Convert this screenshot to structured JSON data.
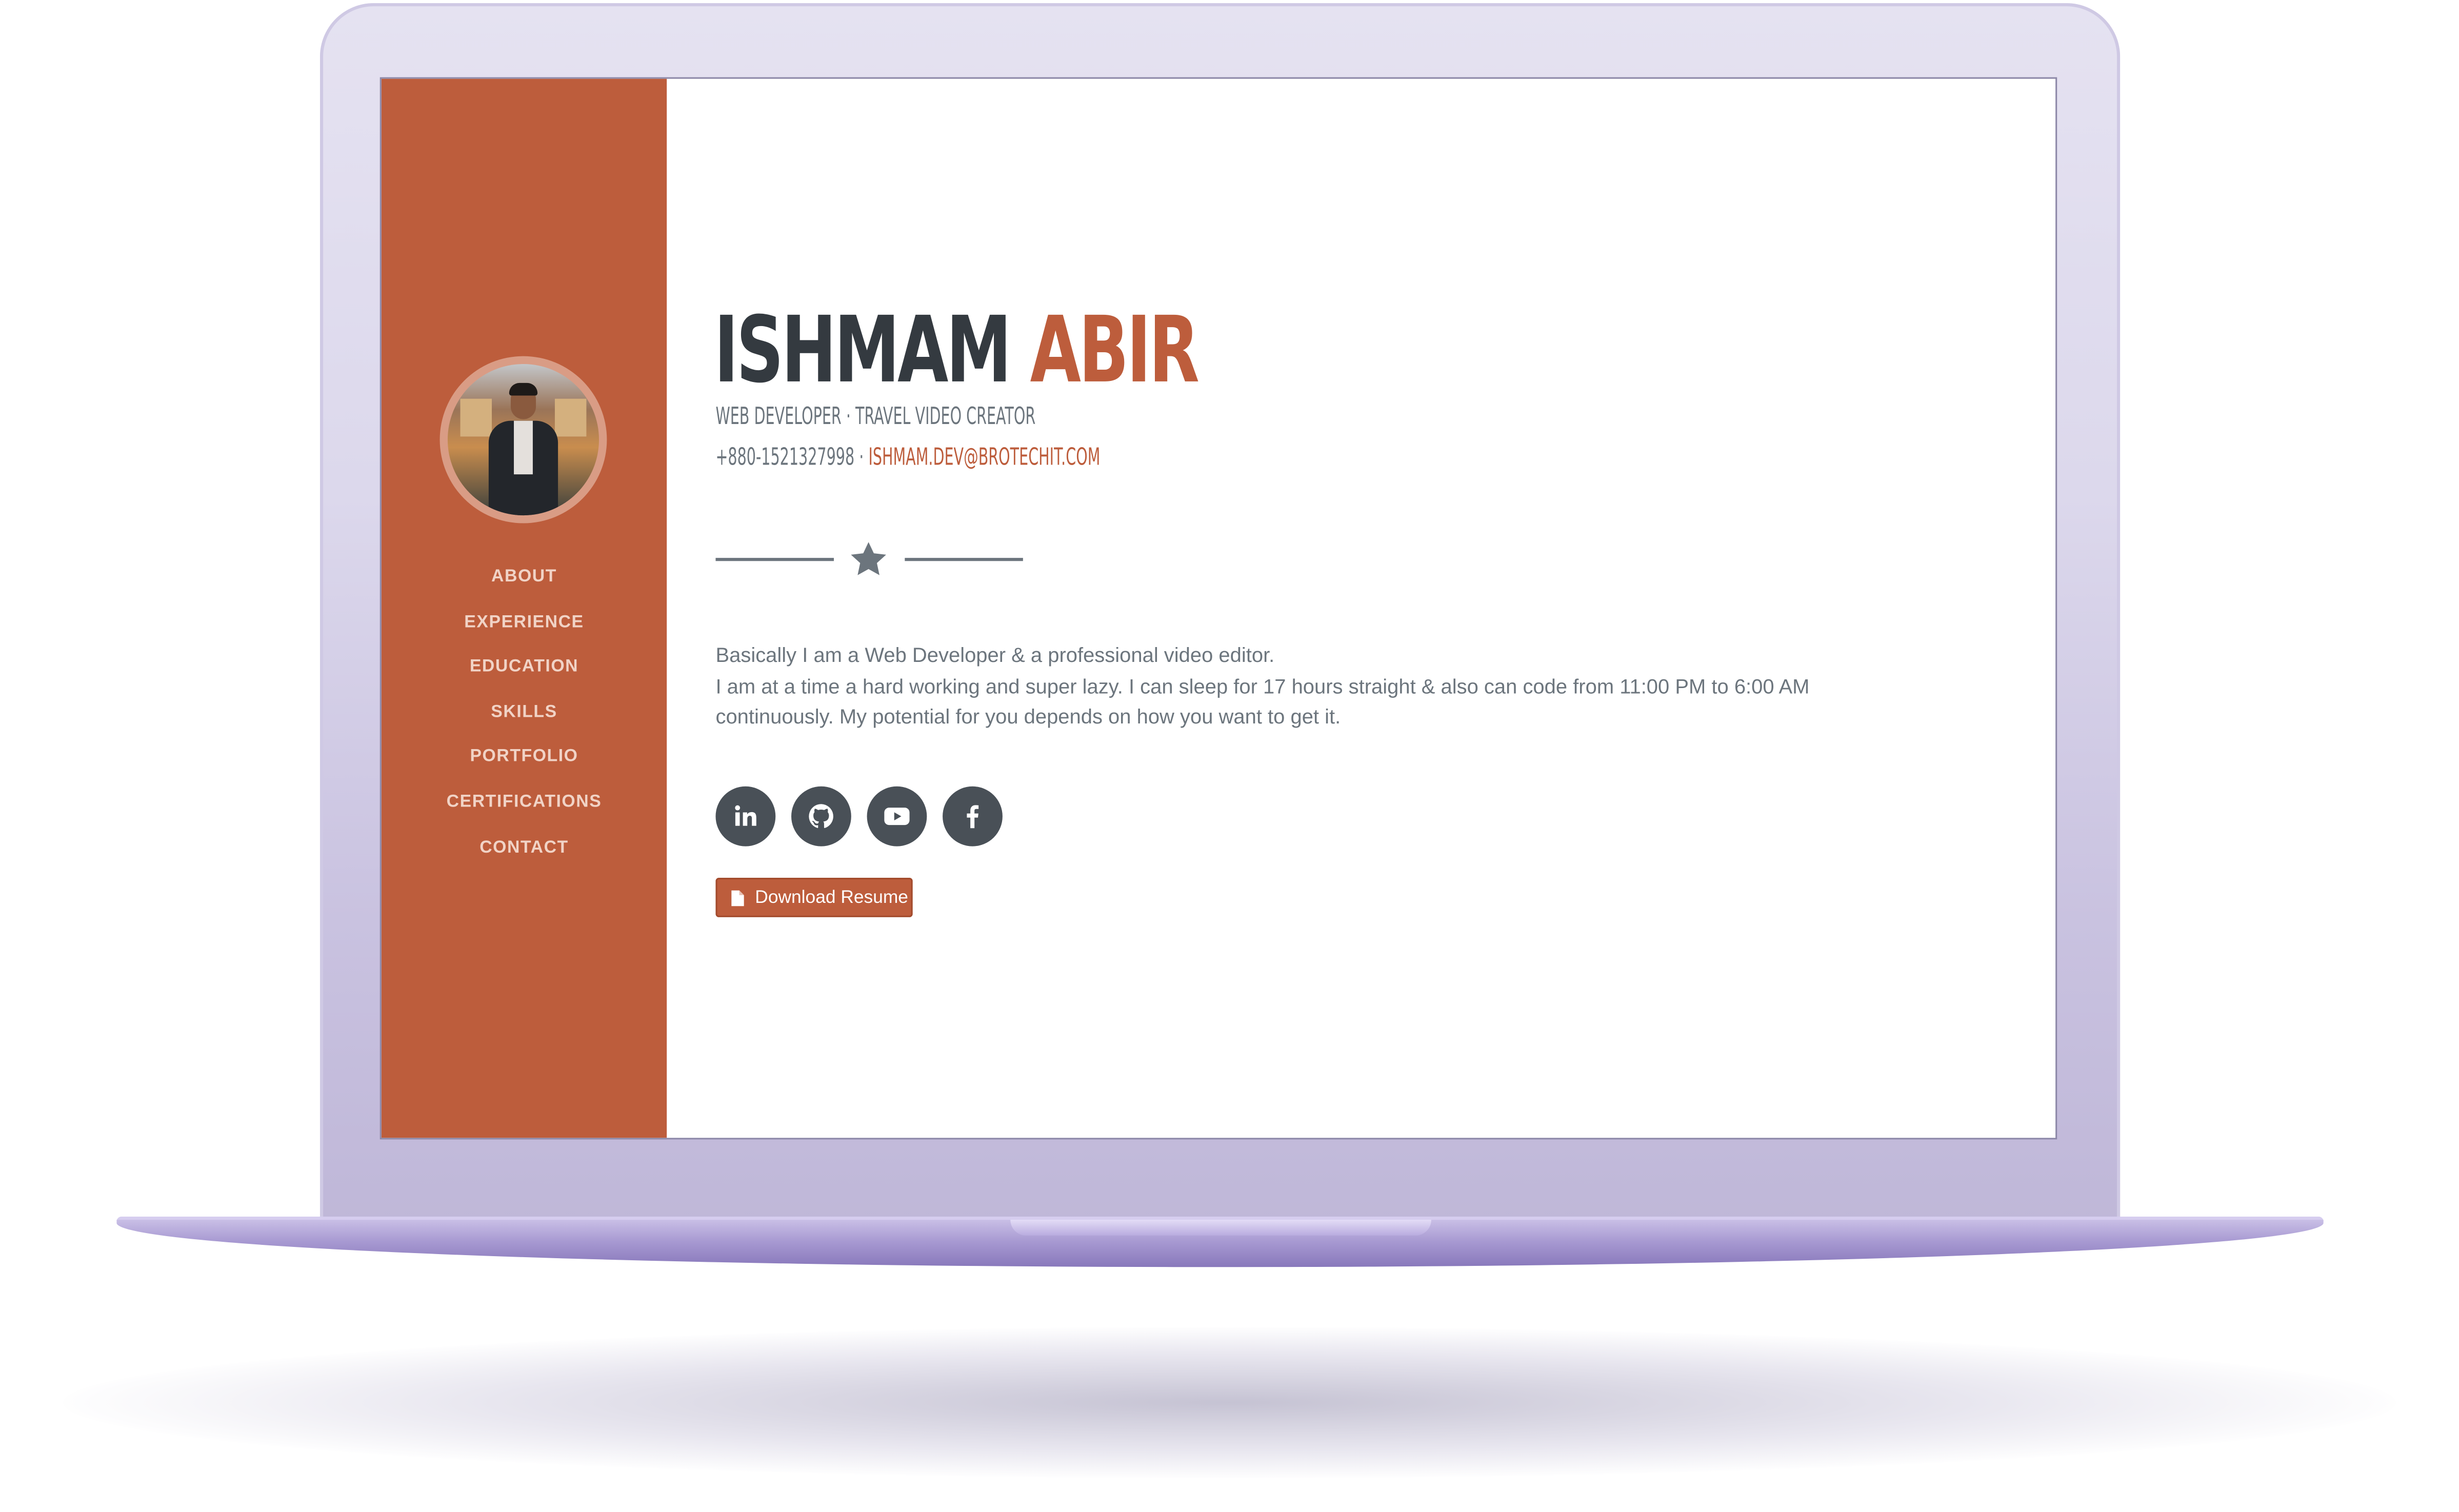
{
  "theme": {
    "accent": "#bd5d3c",
    "dark": "#343a40",
    "muted": "#6c757d",
    "icon_bg": "#495057",
    "laptop": "#dcd8ec"
  },
  "sidebar": {
    "avatar_alt": "profile photo",
    "nav": [
      {
        "label": "ABOUT"
      },
      {
        "label": "EXPERIENCE"
      },
      {
        "label": "EDUCATION"
      },
      {
        "label": "SKILLS"
      },
      {
        "label": "PORTFOLIO"
      },
      {
        "label": "CERTIFICATIONS"
      },
      {
        "label": "CONTACT"
      }
    ]
  },
  "hero": {
    "first_name": "ISHMAM",
    "last_name": "ABIR",
    "subtitle": "WEB DEVELOPER · TRAVEL VIDEO CREATOR",
    "phone": "+880-1521327998",
    "separator": " · ",
    "email": "ISHMAM.DEV@BROTECHIT.COM"
  },
  "bio": {
    "line1": "Basically I am a Web Developer & a professional video editor.",
    "line2": "I am at a time a hard working and super lazy. I can sleep for 17 hours straight & also can code from 11:00 PM to 6:00 AM",
    "line3": "continuously. My potential for you depends on how you want to get it."
  },
  "social": [
    {
      "icon": "linkedin-icon"
    },
    {
      "icon": "github-icon"
    },
    {
      "icon": "youtube-icon"
    },
    {
      "icon": "facebook-icon"
    }
  ],
  "resume_button": {
    "label": "Download Resume",
    "icon": "file-icon"
  }
}
